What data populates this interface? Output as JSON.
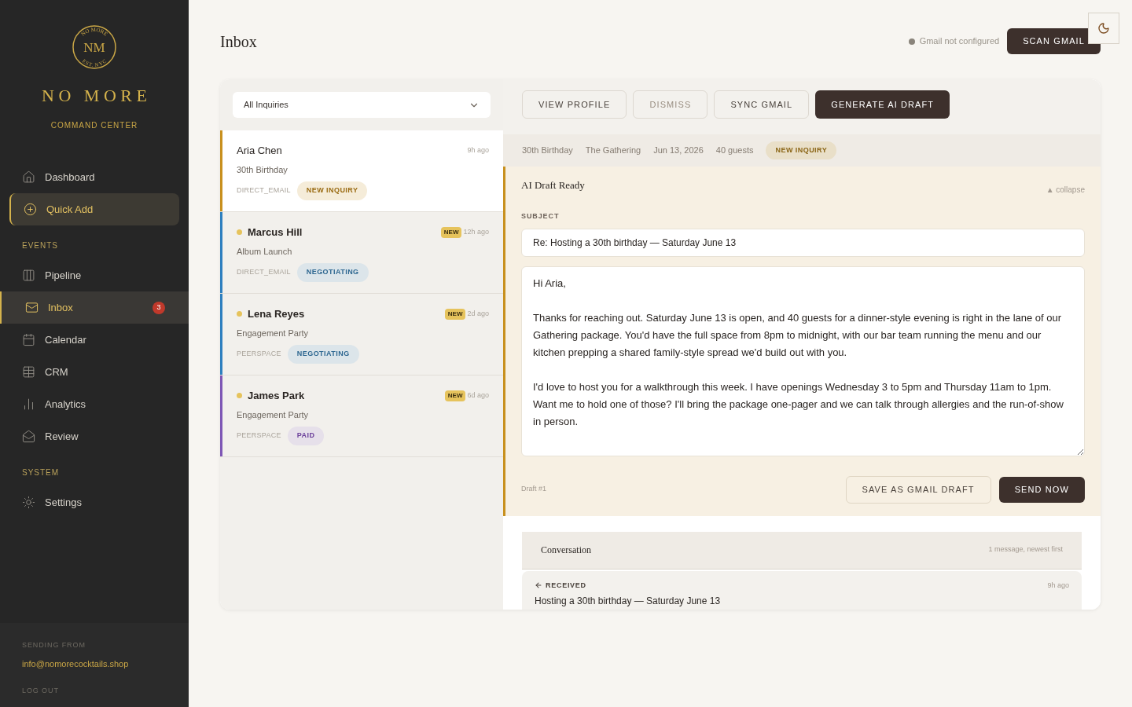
{
  "sidebar": {
    "logo": {
      "monogram": "NM",
      "ring_top": "NO MORE",
      "ring_bottom": "EST. NYC"
    },
    "brand": "NO MORE",
    "subtitle": "COMMAND CENTER",
    "sections": [
      {
        "items": [
          {
            "label": "Dashboard",
            "kind": "link",
            "selected": false
          },
          {
            "label": "Quick Add",
            "kind": "action",
            "selected": false
          }
        ]
      },
      {
        "title": "EVENTS",
        "items": [
          {
            "label": "Pipeline",
            "kind": "link",
            "selected": false
          },
          {
            "label": "Inbox",
            "kind": "link",
            "selected": true,
            "badge": "3"
          },
          {
            "label": "Calendar",
            "kind": "link",
            "selected": false
          },
          {
            "label": "CRM",
            "kind": "link",
            "selected": false
          },
          {
            "label": "Analytics",
            "kind": "link",
            "selected": false
          },
          {
            "label": "Review",
            "kind": "link",
            "selected": false
          }
        ]
      },
      {
        "title": "SYSTEM",
        "items": [
          {
            "label": "Settings",
            "kind": "link",
            "selected": false
          }
        ]
      }
    ],
    "footer": {
      "label": "SENDING FROM",
      "email": "info@nomorecocktails.shop",
      "logout": "LOG OUT"
    }
  },
  "header": {
    "title": "Inbox",
    "gmail_status": "Gmail not configured",
    "scan_button": "SCAN GMAIL"
  },
  "filter": {
    "value": "All Inquiries"
  },
  "inquiries": [
    {
      "name": "Aria Chen",
      "event": "30th Birthday",
      "source": "DIRECT_EMAIL",
      "status": "NEW INQUIRY",
      "kind": "new",
      "time": "9h ago",
      "selected": true,
      "unread": false,
      "color": "#c8901e"
    },
    {
      "name": "Marcus Hill",
      "event": "Album Launch",
      "source": "DIRECT_EMAIL",
      "status": "NEGOTIATING",
      "kind": "negotiating",
      "time": "12h ago",
      "new_label": "NEW",
      "selected": false,
      "unread": true,
      "color": "#2e7fbf"
    },
    {
      "name": "Lena Reyes",
      "event": "Engagement Party",
      "source": "PEERSPACE",
      "status": "NEGOTIATING",
      "kind": "negotiating",
      "time": "2d ago",
      "new_label": "NEW",
      "selected": false,
      "unread": true,
      "color": "#2e7fbf"
    },
    {
      "name": "James Park",
      "event": "Engagement Party",
      "source": "PEERSPACE",
      "status": "PAID",
      "kind": "paid",
      "time": "6d ago",
      "new_label": "NEW",
      "selected": false,
      "unread": true,
      "color": "#7e57b5"
    }
  ],
  "detail": {
    "actions": [
      {
        "label": "VIEW PROFILE",
        "kind": "outline"
      },
      {
        "label": "DISMISS",
        "kind": "muted"
      },
      {
        "label": "SYNC GMAIL",
        "kind": "outline"
      },
      {
        "label": "GENERATE AI DRAFT",
        "kind": "primary"
      }
    ],
    "meta": [
      "30th Birthday",
      "The Gathering",
      "Jun 13, 2026",
      "40 guests"
    ],
    "status": "NEW INQUIRY",
    "draft": {
      "title": "AI Draft Ready",
      "collapse": "▲ collapse",
      "subject_label": "SUBJECT",
      "subject": "Re: Hosting a 30th birthday — Saturday June 13",
      "body": "Hi Aria,\n\nThanks for reaching out. Saturday June 13 is open, and 40 guests for a dinner-style evening is right in the lane of our Gathering package. You'd have the full space from 8pm to midnight, with our bar team running the menu and our kitchen prepping a shared family-style spread we'd build out with you.\n\nI'd love to host you for a walkthrough this week. I have openings Wednesday 3 to 5pm and Thursday 11am to 1pm. Want me to hold one of those? I'll bring the package one-pager and we can talk through allergies and the run-of-show in person.",
      "number": "Draft #1",
      "save": "SAVE AS GMAIL DRAFT",
      "send": "SEND NOW"
    },
    "conversation": {
      "title": "Conversation",
      "count": "1 message, newest first",
      "messages": [
        {
          "direction": "RECEIVED",
          "time": "9h ago",
          "subject": "Hosting a 30th birthday — Saturday June 13"
        }
      ]
    }
  }
}
